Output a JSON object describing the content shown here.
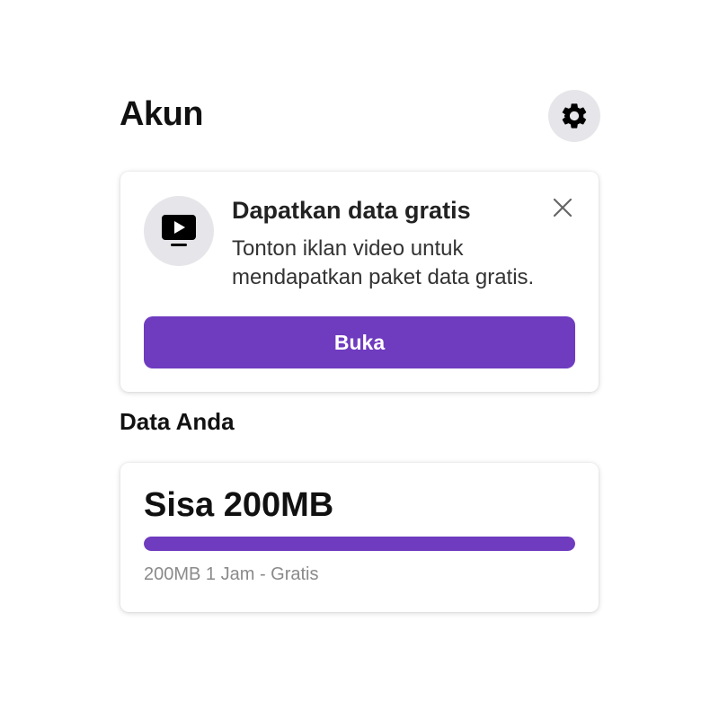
{
  "header": {
    "title": "Akun",
    "settings_icon": "gear-icon"
  },
  "promo": {
    "icon": "tv-play-icon",
    "title": "Dapatkan data gratis",
    "description": "Tonton iklan video untuk mendapatkan paket data gratis.",
    "close_icon": "close-icon",
    "button_label": "Buka"
  },
  "data_section": {
    "title": "Data Anda",
    "remaining": "Sisa 200MB",
    "progress_fraction": 1.0,
    "plan": "200MB 1 Jam - Gratis"
  },
  "colors": {
    "accent": "#6f3bbf",
    "icon_bg": "#e6e6ea",
    "muted_text": "#8a8a8a"
  }
}
